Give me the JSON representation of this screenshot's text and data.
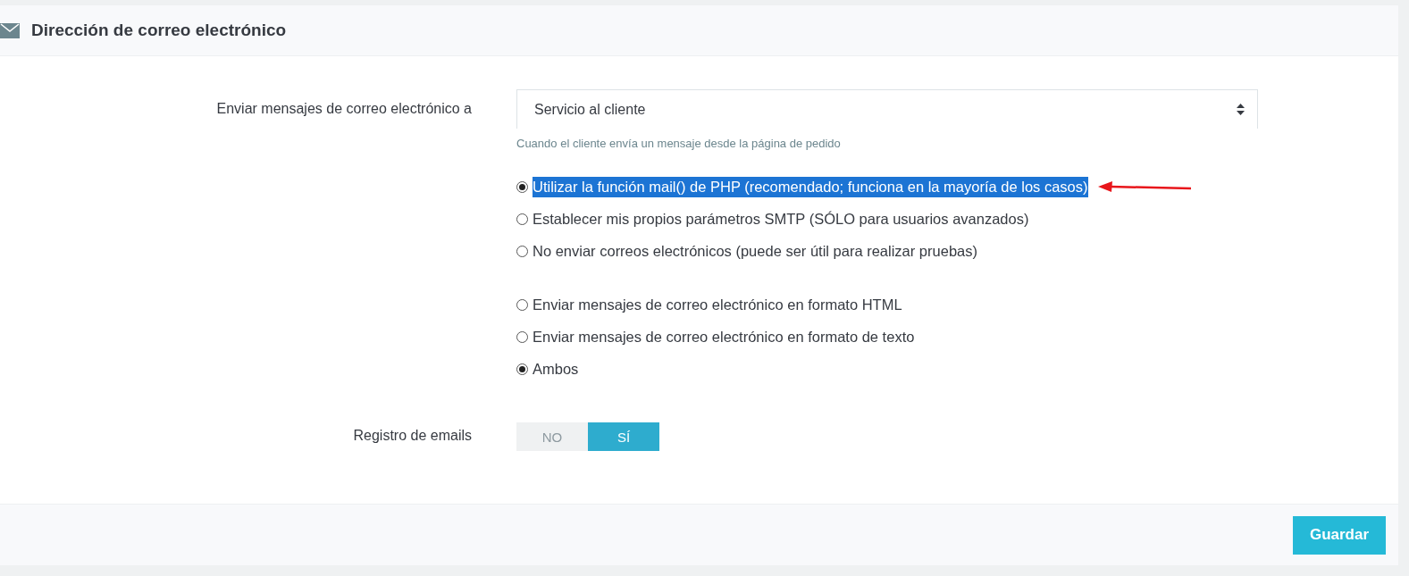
{
  "panel": {
    "title": "Dirección de correo electrónico"
  },
  "send_to": {
    "label": "Enviar mensajes de correo electrónico a",
    "value": "Servicio al cliente",
    "help": "Cuando el cliente envía un mensaje desde la página de pedido"
  },
  "mail_method": [
    {
      "label": "Utilizar la función mail() de PHP (recomendado; funciona en la mayoría de los casos)",
      "selected": true,
      "highlighted": true
    },
    {
      "label": "Establecer mis propios parámetros SMTP (SÓLO para usuarios avanzados)",
      "selected": false,
      "highlighted": false
    },
    {
      "label": "No enviar correos electrónicos (puede ser útil para realizar pruebas)",
      "selected": false,
      "highlighted": false
    }
  ],
  "mail_format": [
    {
      "label": "Enviar mensajes de correo electrónico en formato HTML",
      "selected": false
    },
    {
      "label": "Enviar mensajes de correo electrónico en formato de texto",
      "selected": false
    },
    {
      "label": "Ambos",
      "selected": true
    }
  ],
  "email_log": {
    "label": "Registro de emails",
    "options": [
      {
        "label": "NO",
        "selected": false
      },
      {
        "label": "SÍ",
        "selected": true
      }
    ]
  },
  "footer": {
    "button": "Guardar"
  }
}
